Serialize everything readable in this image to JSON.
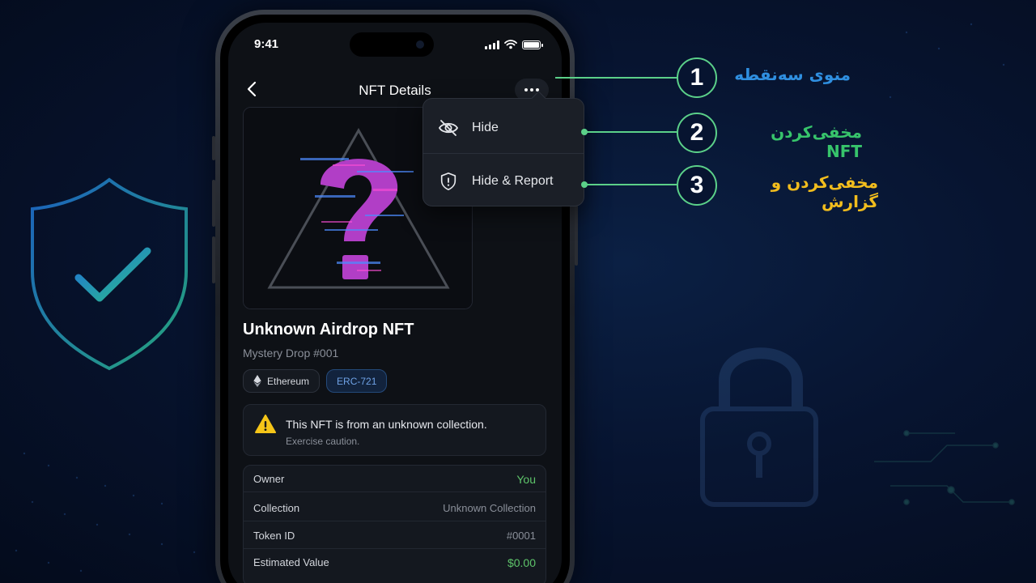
{
  "colors": {
    "accent_green": "#5bd089",
    "annotation_blue": "#2f8fe0",
    "annotation_green": "#37c46b",
    "annotation_yellow": "#f2bd1d",
    "value_green": "#5ec46a",
    "warning_yellow": "#f5c518"
  },
  "status_bar": {
    "time": "9:41"
  },
  "nav": {
    "title": "NFT Details",
    "back_icon": "chevron-left-icon",
    "more_icon": "ellipsis-icon"
  },
  "nft": {
    "name": "Unknown Airdrop NFT",
    "subtitle": "Mystery Drop #001",
    "chips": [
      {
        "label": "Ethereum",
        "icon": "ethereum-icon"
      },
      {
        "label": "ERC-721"
      }
    ]
  },
  "warning": {
    "title": "This NFT is from an unknown collection.",
    "subtitle": "Exercise caution."
  },
  "details": [
    {
      "key": "Owner",
      "value": "You"
    },
    {
      "key": "Collection",
      "value": "Unknown Collection"
    },
    {
      "key": "Token ID",
      "value": "#0001"
    },
    {
      "key": "Estimated Value",
      "value": "$0.00"
    }
  ],
  "menu": {
    "items": [
      {
        "label": "Hide",
        "icon": "eye-off-icon"
      },
      {
        "label": "Hide & Report",
        "icon": "shield-alert-icon"
      }
    ]
  },
  "callouts": [
    {
      "number": "1",
      "text": "منوی سه‌نقطه"
    },
    {
      "number": "2",
      "text": "مخفی‌کردن NFT"
    },
    {
      "number": "3",
      "text": "مخفی‌کردن و گزارش"
    }
  ]
}
